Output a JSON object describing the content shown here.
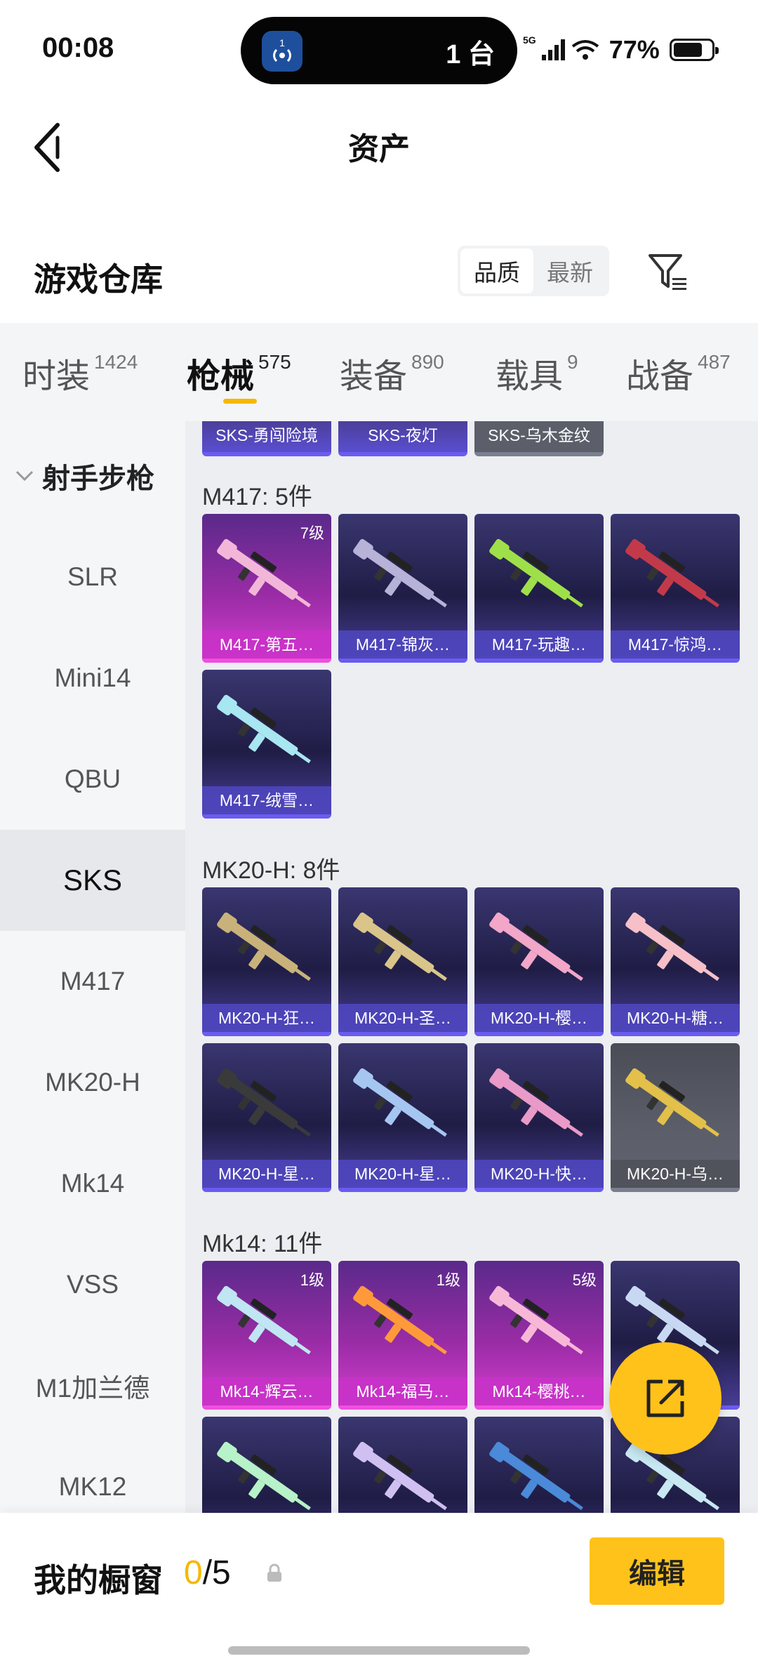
{
  "status_bar": {
    "time": "00:08",
    "island_badge": "1",
    "island_count": "1 台",
    "network": "5G",
    "battery": "77%",
    "battery_level": 0.77
  },
  "header": {
    "title": "资产",
    "back_icon": "chevron-left-icon"
  },
  "section": {
    "title": "游戏仓库",
    "sort_options": [
      "品质",
      "最新"
    ],
    "sort_selected": "品质",
    "filter_icon": "filter-icon"
  },
  "category_tabs": [
    {
      "label": "时装",
      "count": "1424"
    },
    {
      "label": "枪械",
      "count": "575",
      "active": true
    },
    {
      "label": "装备",
      "count": "890"
    },
    {
      "label": "载具",
      "count": "9"
    },
    {
      "label": "战备",
      "count": "487"
    }
  ],
  "sidebar": {
    "group_label": "射手步枪",
    "items": [
      "SLR",
      "Mini14",
      "QBU",
      "SKS",
      "M417",
      "MK20-H",
      "Mk14",
      "VSS",
      "M1加兰德",
      "MK12"
    ],
    "selected": "SKS"
  },
  "content": {
    "sks_partial": [
      "SKS-勇闯险境",
      "SKS-夜灯",
      "SKS-乌木金纹"
    ],
    "groups": [
      {
        "title": "M417: 5件",
        "items": [
          {
            "name": "M417-第五…",
            "rarity": "legend",
            "level": "7级"
          },
          {
            "name": "M417-锦灰…",
            "rarity": "epic"
          },
          {
            "name": "M417-玩趣…",
            "rarity": "epic"
          },
          {
            "name": "M417-惊鸿…",
            "rarity": "epic"
          },
          {
            "name": "M417-绒雪…",
            "rarity": "epic"
          }
        ]
      },
      {
        "title": "MK20-H: 8件",
        "items": [
          {
            "name": "MK20-H-狂…",
            "rarity": "epic"
          },
          {
            "name": "MK20-H-圣…",
            "rarity": "epic"
          },
          {
            "name": "MK20-H-樱…",
            "rarity": "epic"
          },
          {
            "name": "MK20-H-糖…",
            "rarity": "epic"
          },
          {
            "name": "MK20-H-星…",
            "rarity": "epic"
          },
          {
            "name": "MK20-H-星…",
            "rarity": "epic"
          },
          {
            "name": "MK20-H-快…",
            "rarity": "epic"
          },
          {
            "name": "MK20-H-乌…",
            "rarity": "rare"
          }
        ]
      },
      {
        "title": "Mk14: 11件",
        "items": [
          {
            "name": "Mk14-辉云…",
            "rarity": "legend",
            "level": "1级"
          },
          {
            "name": "Mk14-福马…",
            "rarity": "legend",
            "level": "1级"
          },
          {
            "name": "Mk14-樱桃…",
            "rarity": "legend",
            "level": "5级"
          },
          {
            "name": "",
            "rarity": "epic"
          },
          {
            "name": "",
            "rarity": "epic"
          },
          {
            "name": "",
            "rarity": "epic"
          },
          {
            "name": "",
            "rarity": "epic"
          },
          {
            "name": "",
            "rarity": "epic"
          }
        ]
      }
    ]
  },
  "fab": {
    "icon": "share-icon"
  },
  "bottom_bar": {
    "showcase_label": "我的橱窗",
    "showcase_current": "0",
    "showcase_total": "/5",
    "lock_icon": "lock-icon",
    "edit_label": "编辑"
  },
  "colors": {
    "accent": "#ffc21a",
    "legend": "#d53ecf",
    "epic": "#5a4ed0",
    "rare": "#5c5f6a"
  }
}
